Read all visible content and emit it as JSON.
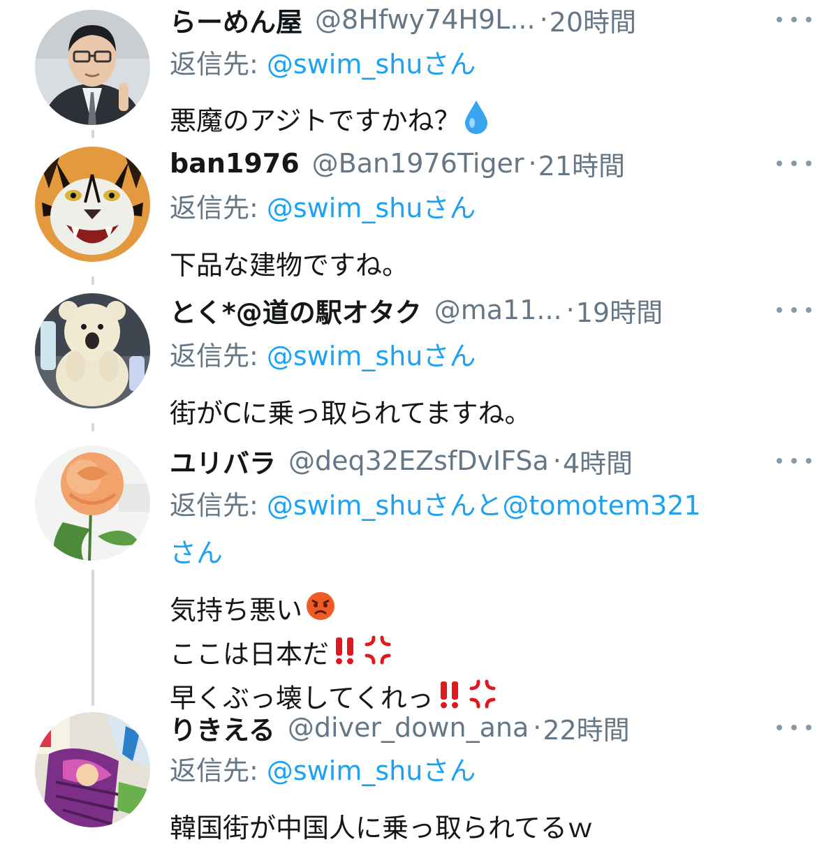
{
  "tweets": [
    {
      "name": "らーめん屋",
      "handle": "@8Hfwy74H9L...",
      "separator": "·",
      "time": "20時間",
      "reply_prefix": "返信先:",
      "reply_to": "@swim_shuさん",
      "body": "悪魔のアジトですかね？",
      "avatar_icon": "man-portrait-avatar",
      "emoji": "droplet-icon"
    },
    {
      "name": "ban1976",
      "handle": "@Ban1976Tiger",
      "separator": "·",
      "time": "21時間",
      "reply_prefix": "返信先:",
      "reply_to": "@swim_shuさん",
      "body": "下品な建物ですね。",
      "avatar_icon": "tiger-avatar"
    },
    {
      "name": "とく*@道の駅オタク",
      "handle": "@ma11...",
      "separator": "·",
      "time": "19時間",
      "reply_prefix": "返信先:",
      "reply_to": "@swim_shuさん",
      "body": "街がCに乗っ取られてますね。",
      "avatar_icon": "teddy-bear-avatar"
    },
    {
      "name": "ユリバラ",
      "handle": "@deq32EZsfDvIFSa",
      "separator": "·",
      "time": "4時間",
      "reply_prefix": "返信先:",
      "reply_to": "@swim_shuさんと@tomotem321",
      "reply_to_2": "さん",
      "body_lines": [
        "気持ち悪い",
        "ここは日本だ",
        "早くぶっ壊してくれっ"
      ],
      "avatar_icon": "rose-avatar"
    },
    {
      "name": "りきえる",
      "handle": "@diver_down_ana",
      "separator": "·",
      "time": "22時間",
      "reply_prefix": "返信先:",
      "reply_to": "@swim_shuさん",
      "body": "韓国街が中国人に乗っ取られてるｗ",
      "avatar_icon": "manga-art-avatar"
    }
  ],
  "colors": {
    "link": "#1da1f2",
    "secondary_text": "#657786",
    "primary_text": "#14171a",
    "thread_line": "#cfd9de"
  }
}
